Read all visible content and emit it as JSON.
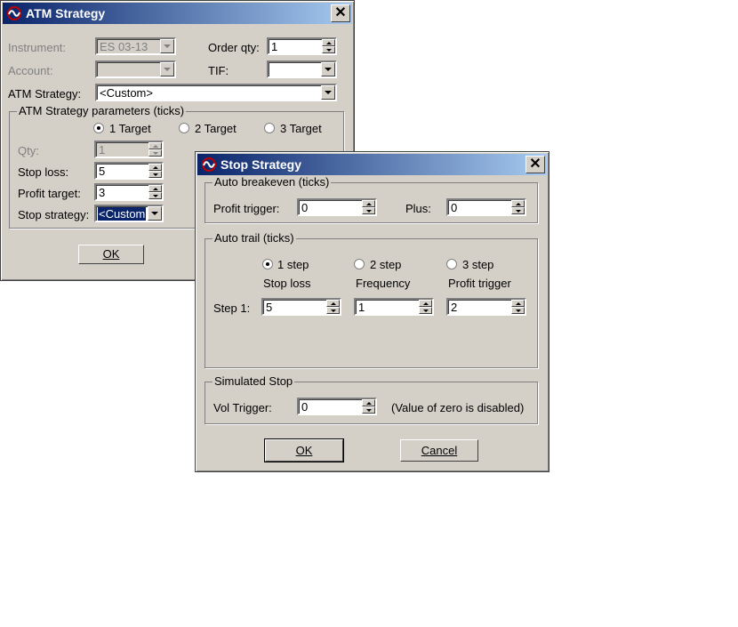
{
  "atm_window": {
    "title": "ATM Strategy",
    "close_glyph": "✕",
    "instrument": {
      "label": "Instrument:",
      "value": "ES 03-13"
    },
    "order_qty": {
      "label": "Order qty:",
      "value": "1"
    },
    "account": {
      "label": "Account:",
      "value": ""
    },
    "tif": {
      "label": "TIF:",
      "value": ""
    },
    "atm_strategy": {
      "label": "ATM Strategy:",
      "value": "<Custom>"
    },
    "params": {
      "title": "ATM Strategy parameters (ticks)",
      "targets": [
        "1 Target",
        "2 Target",
        "3 Target"
      ],
      "selected_target": 0,
      "qty": {
        "label": "Qty:",
        "value": "1"
      },
      "stop_loss": {
        "label": "Stop loss:",
        "value": "5"
      },
      "profit_target": {
        "label": "Profit target:",
        "value": "3"
      },
      "stop_strategy": {
        "label": "Stop strategy:",
        "value": "<Custom"
      }
    },
    "ok_label": "OK"
  },
  "stop_window": {
    "title": "Stop Strategy",
    "close_glyph": "✕",
    "breakeven": {
      "title": "Auto breakeven (ticks)",
      "profit_trigger": {
        "label": "Profit trigger:",
        "value": "0"
      },
      "plus": {
        "label": "Plus:",
        "value": "0"
      }
    },
    "autotrail": {
      "title": "Auto trail (ticks)",
      "steps": [
        "1 step",
        "2 step",
        "3 step"
      ],
      "selected_step": 0,
      "col_stop_loss": "Stop loss",
      "col_frequency": "Frequency",
      "col_profit_trigger": "Profit trigger",
      "step1_label": "Step 1:",
      "step1_stop_loss": "5",
      "step1_frequency": "1",
      "step1_profit_trigger": "2"
    },
    "simulated": {
      "title": "Simulated Stop",
      "vol_trigger": {
        "label": "Vol Trigger:",
        "value": "0"
      },
      "note": "(Value of zero is disabled)"
    },
    "ok_label": "OK",
    "cancel_label": "Cancel"
  },
  "colors": {
    "title_start": "#0a246a",
    "title_end": "#a6caf0",
    "face": "#d4d0c8"
  },
  "icons": {
    "app_icon": "app-logo-icon",
    "close": "close-icon",
    "spin": "spin-arrows-icon",
    "dropdown": "chevron-down-icon"
  }
}
